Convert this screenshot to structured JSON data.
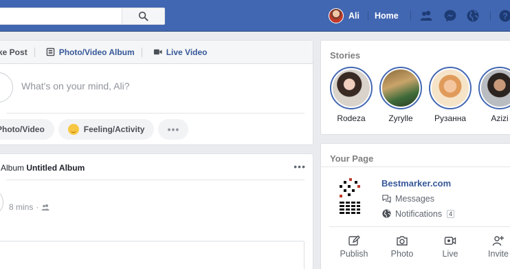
{
  "topbar": {
    "user_name": "Ali",
    "home_label": "Home",
    "icons": [
      "search-icon",
      "friends-icon",
      "messenger-icon",
      "globe-icon",
      "help-icon"
    ]
  },
  "composer": {
    "tabs": [
      {
        "label": "ke Post"
      },
      {
        "label": "Photo/Video Album"
      },
      {
        "label": "Live Video"
      }
    ],
    "placeholder": "What's on your mind, Ali?",
    "actions": {
      "photo_video": "Photo/Video",
      "feeling": "Feeling/Activity",
      "more": "•••"
    }
  },
  "post": {
    "title_prefix": "Album ",
    "title_bold": "Untitled Album",
    "more": "•••",
    "time": "8 mins",
    "sep": "·"
  },
  "stories": {
    "title": "Stories",
    "items": [
      {
        "name": "Rodeza"
      },
      {
        "name": "Zyrylle"
      },
      {
        "name": "Рузанна"
      },
      {
        "name": "Azizi"
      }
    ]
  },
  "your_page": {
    "title": "Your Page",
    "page_name": "Bestmarker.com",
    "messages_label": "Messages",
    "notifications_label": "Notifications",
    "notifications_count": "4",
    "actions": [
      {
        "label": "Publish"
      },
      {
        "label": "Photo"
      },
      {
        "label": "Live"
      },
      {
        "label": "Invite"
      }
    ]
  },
  "colors": {
    "brand_blue": "#4267b2",
    "link_blue": "#365899",
    "background": "#e9ebee"
  }
}
